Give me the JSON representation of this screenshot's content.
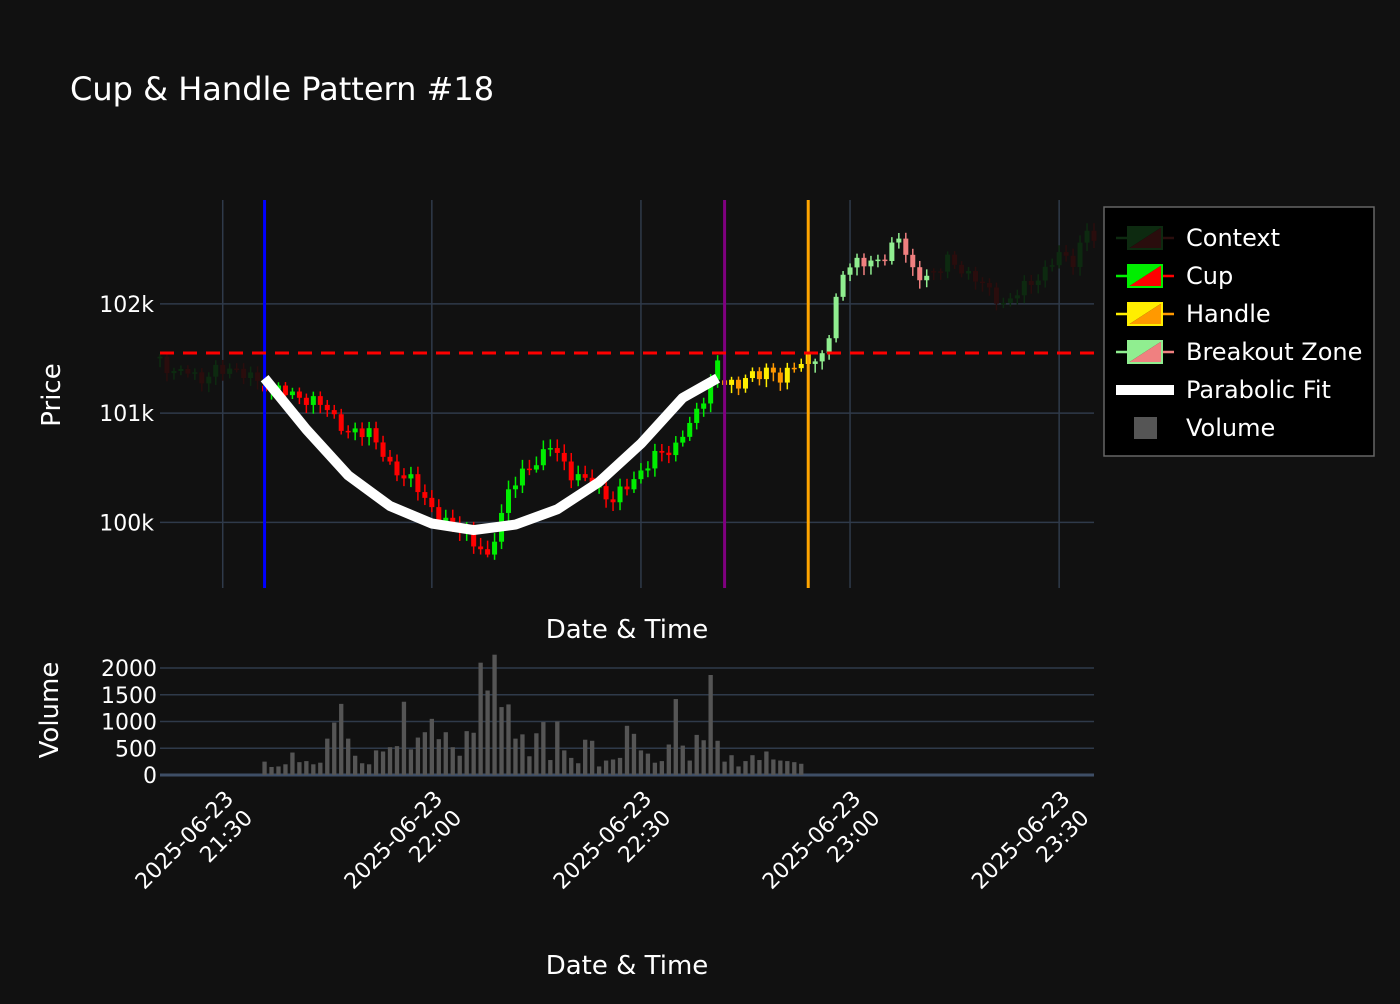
{
  "colors": {
    "background": "#111111",
    "grid": "#2f3a4a",
    "context_up": "#0d2a10",
    "context_down": "#2a0d0d",
    "cup_up": "#00ee00",
    "cup_down": "#ff0000",
    "handle_up": "#ffee00",
    "handle_down": "#ff9900",
    "breakout_up": "#90ee90",
    "breakout_down": "#f08080",
    "parabola": "#ffffff",
    "volume": "#555555",
    "cup_start_line": "#0000ff",
    "cup_end_line": "#800080",
    "handle_end_line": "#ffa500",
    "resistance_line": "#ff0000"
  },
  "chart_data": [
    {
      "type": "candlestick",
      "title": "Cup & Handle Pattern #18",
      "xlabel": "Date & Time",
      "ylabel": "Price",
      "x_range": [
        "2025-06-23 21:21",
        "2025-06-23 23:35"
      ],
      "ylim": [
        99400,
        102950
      ],
      "y_ticks": [
        {
          "value": 100000,
          "label": "100k"
        },
        {
          "value": 101000,
          "label": "101k"
        },
        {
          "value": 102000,
          "label": "102k"
        }
      ],
      "grid": true,
      "legend_position": "right",
      "legend": [
        {
          "label": "Context",
          "kind": "candle",
          "up": "context_up",
          "down": "context_down"
        },
        {
          "label": "Cup",
          "kind": "candle",
          "up": "cup_up",
          "down": "cup_down"
        },
        {
          "label": "Handle",
          "kind": "candle",
          "up": "handle_up",
          "down": "handle_down"
        },
        {
          "label": "Breakout Zone",
          "kind": "candle",
          "up": "breakout_up",
          "down": "breakout_down"
        },
        {
          "label": "Parabolic Fit",
          "kind": "line"
        },
        {
          "label": "Volume",
          "kind": "square"
        }
      ],
      "vertical_lines": [
        {
          "x": "2025-06-23 21:36",
          "color": "cup_start_line"
        },
        {
          "x": "2025-06-23 22:42",
          "color": "cup_end_line"
        },
        {
          "x": "2025-06-23 22:54",
          "color": "handle_end_line"
        }
      ],
      "resistance_level": 101550,
      "segments": [
        {
          "name": "Context",
          "start": "2025-06-23 21:21",
          "end": "2025-06-23 21:35",
          "anchors": [
            [
              0,
              101500
            ],
            [
              2,
              101350
            ],
            [
              4,
              101400
            ],
            [
              6,
              101300
            ],
            [
              8,
              101380
            ],
            [
              10,
              101420
            ],
            [
              12,
              101350
            ],
            [
              14,
              101300
            ]
          ]
        },
        {
          "name": "Cup",
          "start": "2025-06-23 21:36",
          "end": "2025-06-23 22:41",
          "anchors": [
            [
              0,
              101250
            ],
            [
              5,
              101150
            ],
            [
              9,
              101050
            ],
            [
              12,
              100800
            ],
            [
              15,
              100850
            ],
            [
              18,
              100500
            ],
            [
              21,
              100400
            ],
            [
              23,
              100200
            ],
            [
              26,
              100000
            ],
            [
              29,
              99900
            ],
            [
              31,
              99750
            ],
            [
              32,
              99650
            ],
            [
              35,
              100300
            ],
            [
              38,
              100500
            ],
            [
              41,
              100700
            ],
            [
              44,
              100450
            ],
            [
              47,
              100350
            ],
            [
              50,
              100200
            ],
            [
              53,
              100400
            ],
            [
              56,
              100600
            ],
            [
              59,
              100700
            ],
            [
              62,
              101000
            ],
            [
              65,
              101450
            ]
          ]
        },
        {
          "name": "Handle",
          "start": "2025-06-23 22:42",
          "end": "2025-06-23 22:54",
          "anchors": [
            [
              0,
              101300
            ],
            [
              2,
              101250
            ],
            [
              4,
              101350
            ],
            [
              6,
              101400
            ],
            [
              8,
              101300
            ],
            [
              10,
              101450
            ],
            [
              12,
              101500
            ]
          ]
        },
        {
          "name": "Breakout Zone",
          "start": "2025-06-23 22:55",
          "end": "2025-06-23 23:11",
          "anchors": [
            [
              0,
              101450
            ],
            [
              2,
              101700
            ],
            [
              4,
              102300
            ],
            [
              6,
              102400
            ],
            [
              8,
              102350
            ],
            [
              10,
              102450
            ],
            [
              12,
              102600
            ],
            [
              14,
              102300
            ],
            [
              16,
              102250
            ]
          ]
        },
        {
          "name": "Context",
          "start": "2025-06-23 23:12",
          "end": "2025-06-23 23:35",
          "anchors": [
            [
              0,
              102300
            ],
            [
              2,
              102400
            ],
            [
              4,
              102300
            ],
            [
              6,
              102250
            ],
            [
              8,
              102100
            ],
            [
              10,
              102000
            ],
            [
              12,
              102100
            ],
            [
              14,
              102200
            ],
            [
              16,
              102300
            ],
            [
              18,
              102450
            ],
            [
              20,
              102400
            ],
            [
              22,
              102650
            ],
            [
              23,
              102600
            ]
          ]
        }
      ],
      "parabolic_fit": [
        {
          "x": "2025-06-23 21:36",
          "y": 101320
        },
        {
          "x": "2025-06-23 21:42",
          "y": 100850
        },
        {
          "x": "2025-06-23 21:48",
          "y": 100430
        },
        {
          "x": "2025-06-23 21:54",
          "y": 100150
        },
        {
          "x": "2025-06-23 22:00",
          "y": 99990
        },
        {
          "x": "2025-06-23 22:06",
          "y": 99930
        },
        {
          "x": "2025-06-23 22:12",
          "y": 99980
        },
        {
          "x": "2025-06-23 22:18",
          "y": 100120
        },
        {
          "x": "2025-06-23 22:24",
          "y": 100370
        },
        {
          "x": "2025-06-23 22:30",
          "y": 100720
        },
        {
          "x": "2025-06-23 22:36",
          "y": 101140
        },
        {
          "x": "2025-06-23 22:41",
          "y": 101320
        }
      ]
    },
    {
      "type": "bar",
      "xlabel": "Date & Time",
      "ylabel": "Volume",
      "ylim": [
        0,
        2300
      ],
      "y_ticks": [
        {
          "value": 0,
          "label": "0"
        },
        {
          "value": 500,
          "label": "500"
        },
        {
          "value": 1000,
          "label": "1000"
        },
        {
          "value": 1500,
          "label": "1500"
        },
        {
          "value": 2000,
          "label": "2000"
        }
      ],
      "x_ticks": [
        {
          "x": "2025-06-23 21:30",
          "date": "2025-06-23",
          "time": "21:30"
        },
        {
          "x": "2025-06-23 22:00",
          "date": "2025-06-23",
          "time": "22:00"
        },
        {
          "x": "2025-06-23 22:30",
          "date": "2025-06-23",
          "time": "22:30"
        },
        {
          "x": "2025-06-23 23:00",
          "date": "2025-06-23",
          "time": "23:00"
        },
        {
          "x": "2025-06-23 23:30",
          "date": "2025-06-23",
          "time": "23:30"
        }
      ],
      "volume_start": "2025-06-23 21:36",
      "volume": [
        250,
        150,
        160,
        200,
        420,
        240,
        260,
        200,
        230,
        680,
        980,
        1330,
        680,
        360,
        220,
        200,
        460,
        440,
        520,
        540,
        1370,
        480,
        700,
        800,
        1050,
        670,
        800,
        520,
        360,
        820,
        790,
        2100,
        1580,
        2250,
        1270,
        1320,
        680,
        760,
        350,
        780,
        990,
        280,
        1000,
        460,
        320,
        220,
        660,
        640,
        160,
        270,
        290,
        320,
        920,
        770,
        460,
        400,
        230,
        260,
        570,
        1420,
        550,
        270,
        750,
        650,
        1870,
        640,
        250,
        370,
        160,
        260,
        370,
        280,
        440,
        290,
        270,
        260,
        240,
        210
      ]
    }
  ]
}
